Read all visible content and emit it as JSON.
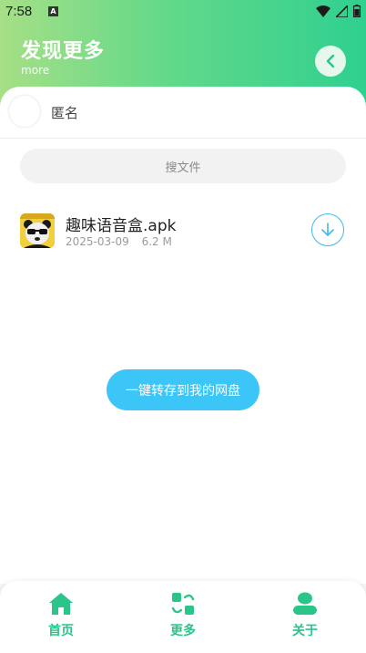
{
  "status_bar": {
    "time": "7:58",
    "notification_badge": "A"
  },
  "header": {
    "title": "发现更多",
    "subtitle": "more"
  },
  "user": {
    "name": "匿名"
  },
  "search": {
    "placeholder": "搜文件"
  },
  "file": {
    "name": "趣味语音盒.apk",
    "date": "2025-03-09",
    "size": "6.2 M",
    "icon": "panda-avatar-icon"
  },
  "actions": {
    "save_label": "一键转存到我的网盘"
  },
  "tabbar": {
    "items": [
      {
        "label": "首页",
        "icon": "home-icon"
      },
      {
        "label": "更多",
        "icon": "more-apps-icon"
      },
      {
        "label": "关于",
        "icon": "person-icon"
      }
    ]
  },
  "colors": {
    "header_gradient_start": "#a6df86",
    "header_gradient_end": "#2fd08f",
    "accent_green": "#2bc58a",
    "button_blue": "#3cc6f7",
    "download_blue": "#40b9ea"
  }
}
